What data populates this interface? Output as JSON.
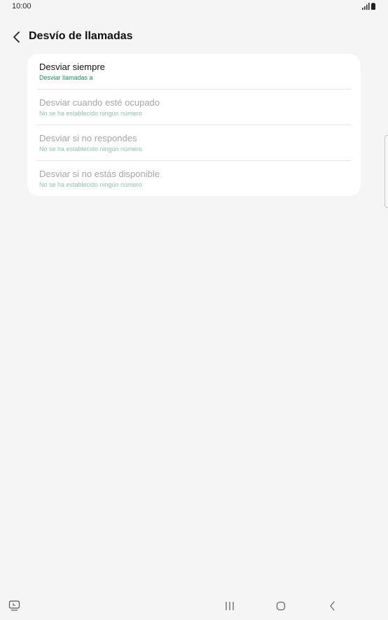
{
  "status_bar": {
    "time": "10:00",
    "icons": [
      "signal-icon",
      "battery-icon"
    ]
  },
  "header": {
    "back_icon": "back-arrow-icon",
    "title": "Desvío de llamadas"
  },
  "forwarding_options": [
    {
      "label": "Desviar siempre",
      "summary": "Desviar llamadas a",
      "enabled": true
    },
    {
      "label": "Desviar cuando esté ocupado",
      "summary": "No se ha establecido ningún número",
      "enabled": false
    },
    {
      "label": "Desviar si no respondes",
      "summary": "No se ha establecido ningún número",
      "enabled": false
    },
    {
      "label": "Desviar si no estás disponible",
      "summary": "No se ha establecido ningún número",
      "enabled": false
    }
  ],
  "colors": {
    "background": "#f5f5f5",
    "card": "#ffffff",
    "accent": "#1f8a5d",
    "disabled_text": "#a6a6a6",
    "disabled_accent": "#8fc4ad"
  },
  "nav_bar": {
    "left_icon": "keyboard-switch-icon",
    "buttons": [
      "recent-apps-icon",
      "home-icon",
      "back-icon"
    ]
  }
}
